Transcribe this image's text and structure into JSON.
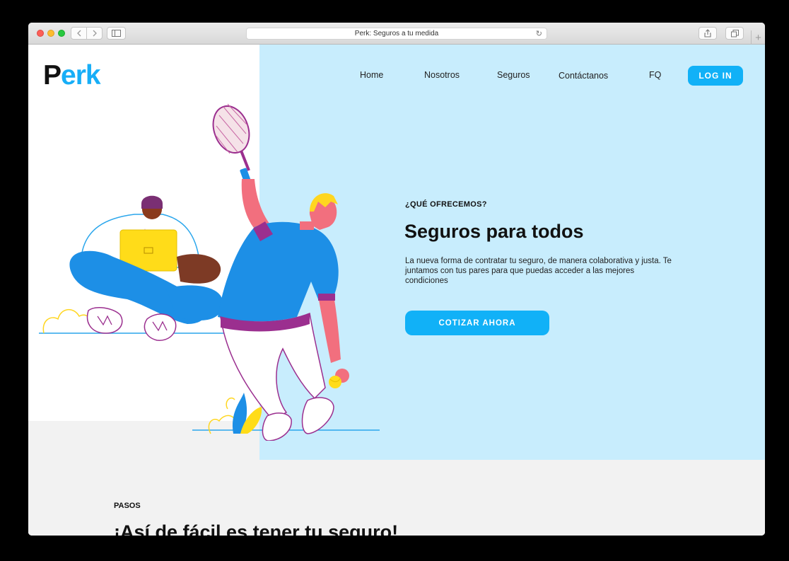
{
  "browser": {
    "url_title": "Perk: Seguros a tu medida",
    "reload_icon": "reload-icon",
    "add_tab": "+"
  },
  "header": {
    "logo_p": "P",
    "logo_rest": "erk",
    "nav": [
      {
        "label": "Home"
      },
      {
        "label": "Nosotros"
      },
      {
        "label": "Seguros"
      },
      {
        "label": "Contáctanos"
      },
      {
        "label": "FQ"
      }
    ],
    "login_label": "LOG IN"
  },
  "hero": {
    "eyebrow": "¿QUÉ OFRECEMOS?",
    "title": "Seguros para todos",
    "description": "La nueva forma de contratar tu seguro, de manera colaborativa y justa. Te juntamos con tus pares para que puedas acceder a las mejores condiciones",
    "cta_label": "COTIZAR AHORA"
  },
  "steps": {
    "eyebrow": "PASOS",
    "title": "¡Así de fácil es tener tu seguro!"
  },
  "colors": {
    "accent": "#11b1f7",
    "panel": "#c8edfd",
    "logo_blue": "#17aef7",
    "band": "#f2f2f2"
  }
}
